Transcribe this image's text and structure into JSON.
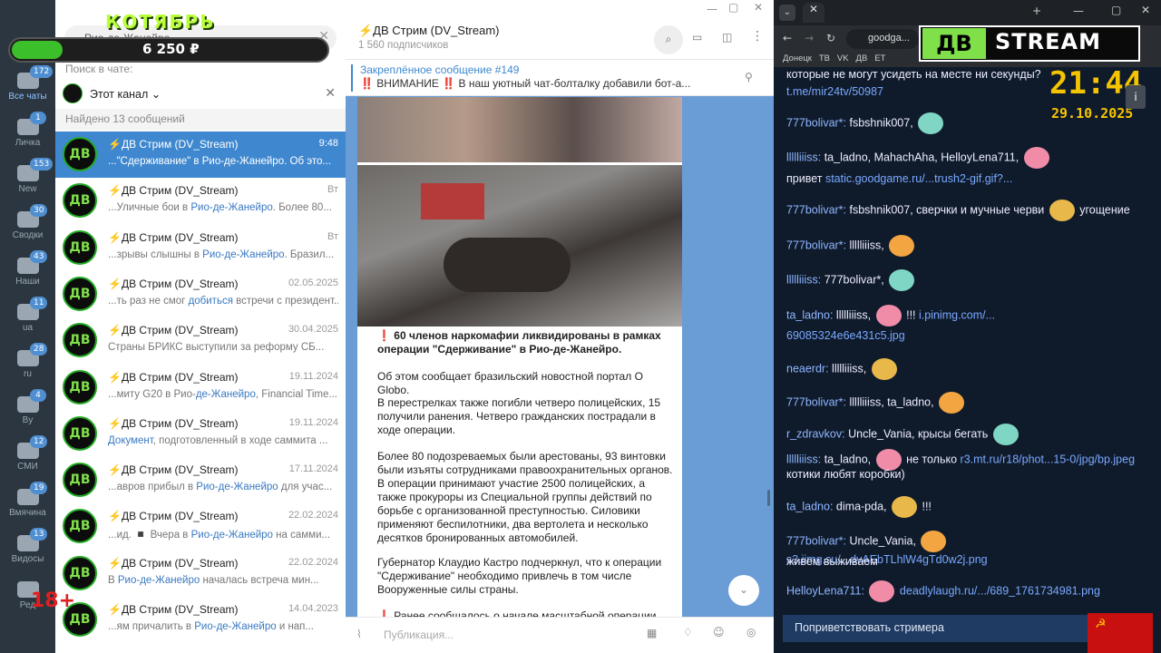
{
  "overlay": {
    "month": "КОТЯБРЬ",
    "amount": "6 250 ₽",
    "age": "18+"
  },
  "rail": {
    "items": [
      {
        "label": "Все чаты",
        "badge": "172"
      },
      {
        "label": "Личка",
        "badge": "1"
      },
      {
        "label": "New",
        "badge": "153"
      },
      {
        "label": "Сводки",
        "badge": "30"
      },
      {
        "label": "Наши",
        "badge": "43"
      },
      {
        "label": "ua",
        "badge": "11"
      },
      {
        "label": "ru",
        "badge": "28"
      },
      {
        "label": "By",
        "badge": "4"
      },
      {
        "label": "СМИ",
        "badge": "12"
      },
      {
        "label": "Вмячина",
        "badge": "19"
      },
      {
        "label": "Видосы",
        "badge": "13"
      },
      {
        "label": "Ред",
        "badge": ""
      }
    ]
  },
  "search": {
    "placeholder": "Поиск в чате:",
    "scope": "Этот канал",
    "found": "Найдено 13 сообщений",
    "query": "Рио-де-Жанейро"
  },
  "results": [
    {
      "name": "⚡ДВ Стрим (DV_Stream)",
      "date": "9:48",
      "pre": "...\"Сдерживание\" в ",
      "hl": "Рио-де-Жанейро",
      "post": ". Об это..."
    },
    {
      "name": "⚡ДВ Стрим (DV_Stream)",
      "date": "Вт",
      "pre": "...Уличные бои в ",
      "hl": "Рио-де-Жанейро",
      "post": ". Более 80..."
    },
    {
      "name": "⚡ДВ Стрим (DV_Stream)",
      "date": "Вт",
      "pre": "...зрывы слышны в ",
      "hl": "Рио-де-Жанейро",
      "post": ". Бразил..."
    },
    {
      "name": "⚡ДВ Стрим (DV_Stream)",
      "date": "02.05.2025",
      "pre": "...ть раз не смог ",
      "hl": "добиться",
      "post": " встречи с президент..."
    },
    {
      "name": "⚡ДВ Стрим (DV_Stream)",
      "date": "30.04.2025",
      "pre": "Страны БРИКС выступили за реформу СБ...",
      "hl": "",
      "post": ""
    },
    {
      "name": "⚡ДВ Стрим (DV_Stream)",
      "date": "19.11.2024",
      "pre": "...миту G20 в Рио-",
      "hl": "де-Жанейро",
      "post": ", Financial Time..."
    },
    {
      "name": "⚡ДВ Стрим (DV_Stream)",
      "date": "19.11.2024",
      "pre": "",
      "hl": "Документ",
      "post": ", подготовленный в ходе саммита ..."
    },
    {
      "name": "⚡ДВ Стрим (DV_Stream)",
      "date": "17.11.2024",
      "pre": "...авров прибыл в ",
      "hl": "Рио-де-Жанейро",
      "post": " для учас..."
    },
    {
      "name": "⚡ДВ Стрим (DV_Stream)",
      "date": "22.02.2024",
      "pre": "...ид. ◾ Вчера в ",
      "hl": "Рио-де-Жанейро",
      "post": " на самми..."
    },
    {
      "name": "⚡ДВ Стрим (DV_Stream)",
      "date": "22.02.2024",
      "pre": "В ",
      "hl": "Рио-де-Жанейро",
      "post": " началась встреча мин..."
    },
    {
      "name": "⚡ДВ Стрим (DV_Stream)",
      "date": "14.04.2023",
      "pre": "...ям причалить в ",
      "hl": "Рио-де-Жанейро",
      "post": " и нап..."
    }
  ],
  "chat": {
    "title": "⚡ДВ Стрим (DV_Stream)",
    "subs": "1 560 подписчиков",
    "pinned_label": "Закреплённое сообщение #149",
    "pinned_text": "‼️ ВНИМАНИЕ ‼️ В наш уютный чат-болталку добавили бот-а...",
    "headline": "❗ 60 членов наркомафии ликвидированы в рамках операции \"Сдерживание\" в Рио-де-Жанейро.",
    "p1": "Об этом сообщает бразильский новостной портал O Globo.",
    "p2": "В перестрелках также погибли четверо полицейских, 15 получили ранения. Четверо гражданских пострадали в ходе операции.",
    "p3": "Более 80 подозреваемых были арестованы, 93 винтовки были изъяты сотрудниками правоохранительных органов. В операции принимают участие 2500 полицейских, а также прокуроры из Специальной группы действий по борьбе с организованной преступностью. Силовики применяют беспилотники, два вертолета и несколько десятков бронированных автомобилей.",
    "p4": "Губернатор Клаудио Кастро подчеркнул, что к операции \"Сдерживание\" необходимо привлечь в том числе Вооруженные силы страны.",
    "p5": "❗ Ранее сообщалось о начале масштабной операции по...",
    "composer_placeholder": "Публикация..."
  },
  "browser": {
    "url": "goodga...",
    "bookmarks": "Донецк   ТВ   VK   ДВ   ЕТ"
  },
  "stream": {
    "logo_a": "ДВ",
    "logo_b": "STREAM",
    "time": "21:44",
    "date": "29.10.2025"
  },
  "chatlog": [
    {
      "nick": "",
      "text": "которые не могут усидеть на месте ни секунды?"
    },
    {
      "nick": "",
      "link": "t.me/mir24tv/50987"
    },
    {
      "nick": "777bolivar*:",
      "text": "fsbshnik007,"
    },
    {
      "nick": "llllliiiss:",
      "text": "ta_ladno, MahachAha, HelloyLena711,"
    },
    {
      "nick": "",
      "text": "привет",
      "link": "static.goodgame.ru/...trush2-gif.gif?..."
    },
    {
      "nick": "777bolivar*:",
      "text": "fsbshnik007, сверчки и мучные черви",
      "tail": "угощение"
    },
    {
      "nick": "777bolivar*:",
      "text": "llllliiiss,"
    },
    {
      "nick": "llllliiiss:",
      "text": "777bolivar*,"
    },
    {
      "nick": "ta_ladno:",
      "text": "llllliiiss,",
      "tail": "!!!",
      "link": "i.pinimg.com/..."
    },
    {
      "nick": "",
      "link": "69085324e6e431c5.jpg"
    },
    {
      "nick": "neaerdr:",
      "text": "llllliiiss,"
    },
    {
      "nick": "777bolivar*:",
      "text": "llllliiiss, ta_ladno,"
    },
    {
      "nick": "r_zdravkov:",
      "text": "Uncle_Vania, крысы бегать"
    },
    {
      "nick": "llllliiiss:",
      "text": "ta_ladno,",
      "link": "r3.mt.ru/r18/phot...15-0/jpg/bp.jpeg",
      "tail": "не только"
    },
    {
      "nick": "",
      "text": "котики любят коробки)"
    },
    {
      "nick": "ta_ladno:",
      "text": "dima-pda,",
      "tail": "!!!"
    },
    {
      "nick": "777bolivar*:",
      "text": "Uncle_Vania,",
      "link": "s3.iimg.su/...dvAEbTLhlW4gTd0w2j.png"
    },
    {
      "nick": "",
      "text": "живем выживаем"
    },
    {
      "nick": "HelloyLena711:",
      "link": "deadlylaugh.ru/.../689_1761734981.png"
    }
  ],
  "greet_button": "Поприветствовать стримера"
}
